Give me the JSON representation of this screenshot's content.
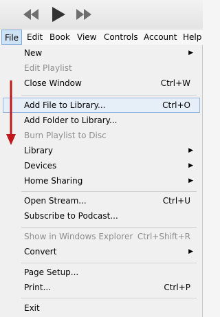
{
  "colors": {
    "accent_red": "#c0161c",
    "highlight": "#e6eef8"
  },
  "toolbar": {
    "icons": [
      "rewind-icon",
      "play-icon",
      "fast-forward-icon"
    ]
  },
  "menubar": {
    "items": [
      "File",
      "Edit",
      "Book",
      "View",
      "Controls",
      "Account",
      "Help"
    ]
  },
  "file_menu": {
    "items": [
      {
        "label": "New",
        "shortcut": "",
        "submenu": true,
        "disabled": false
      },
      {
        "label": "Edit Playlist",
        "shortcut": "",
        "submenu": false,
        "disabled": true
      },
      {
        "label": "Close Window",
        "shortcut": "Ctrl+W",
        "submenu": false,
        "disabled": false
      },
      {
        "label": "Add File to Library...",
        "shortcut": "Ctrl+O",
        "submenu": false,
        "disabled": false,
        "highlighted": true
      },
      {
        "label": "Add Folder to Library...",
        "shortcut": "",
        "submenu": false,
        "disabled": false
      },
      {
        "label": "Burn Playlist to Disc",
        "shortcut": "",
        "submenu": false,
        "disabled": true
      },
      {
        "label": "Library",
        "shortcut": "",
        "submenu": true,
        "disabled": false
      },
      {
        "label": "Devices",
        "shortcut": "",
        "submenu": true,
        "disabled": false
      },
      {
        "label": "Home Sharing",
        "shortcut": "",
        "submenu": true,
        "disabled": false
      },
      {
        "label": "Open Stream...",
        "shortcut": "Ctrl+U",
        "submenu": false,
        "disabled": false
      },
      {
        "label": "Subscribe to Podcast...",
        "shortcut": "",
        "submenu": false,
        "disabled": false
      },
      {
        "label": "Show in Windows Explorer",
        "shortcut": "Ctrl+Shift+R",
        "submenu": false,
        "disabled": true
      },
      {
        "label": "Convert",
        "shortcut": "",
        "submenu": true,
        "disabled": false
      },
      {
        "label": "Page Setup...",
        "shortcut": "",
        "submenu": false,
        "disabled": false
      },
      {
        "label": "Print...",
        "shortcut": "Ctrl+P",
        "submenu": false,
        "disabled": false
      },
      {
        "label": "Exit",
        "shortcut": "",
        "submenu": false,
        "disabled": false
      }
    ]
  }
}
